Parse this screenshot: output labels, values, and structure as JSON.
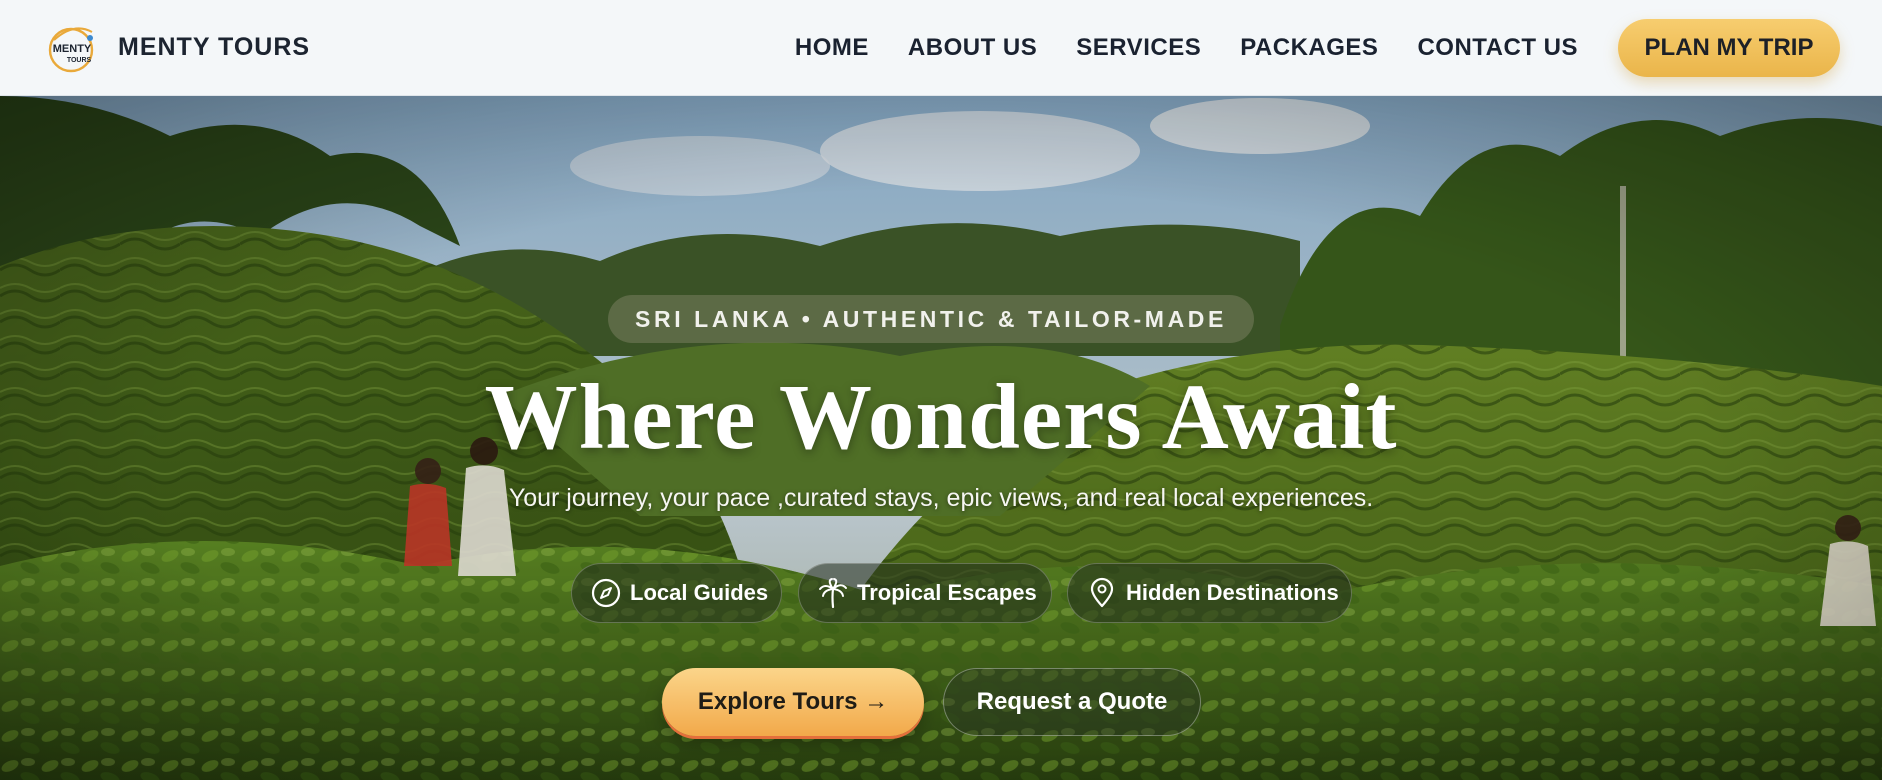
{
  "header": {
    "brand": "MENTY TOURS",
    "logo_text_top": "MENTY",
    "logo_text_bottom": "TOURS",
    "nav": [
      "HOME",
      "ABOUT US",
      "SERVICES",
      "PACKAGES",
      "CONTACT US"
    ],
    "plan_button": "PLAN MY TRIP"
  },
  "hero": {
    "tagline": "SRI LANKA • AUTHENTIC & TAILOR-MADE",
    "title": "Where Wonders Await",
    "subtitle": "Your journey, your pace ,curated stays, epic views, and real local experiences.",
    "chips": [
      {
        "label": "Local Guides",
        "icon": "compass-icon"
      },
      {
        "label": "Tropical Escapes",
        "icon": "palm-tree-icon"
      },
      {
        "label": "Hidden Destinations",
        "icon": "map-pin-icon"
      }
    ],
    "primary_cta": "Explore Tours →",
    "secondary_cta": "Request a Quote"
  },
  "colors": {
    "accent": "#f2b94f",
    "header_bg": "#f4f7f9",
    "nav_text": "#1a2230"
  }
}
